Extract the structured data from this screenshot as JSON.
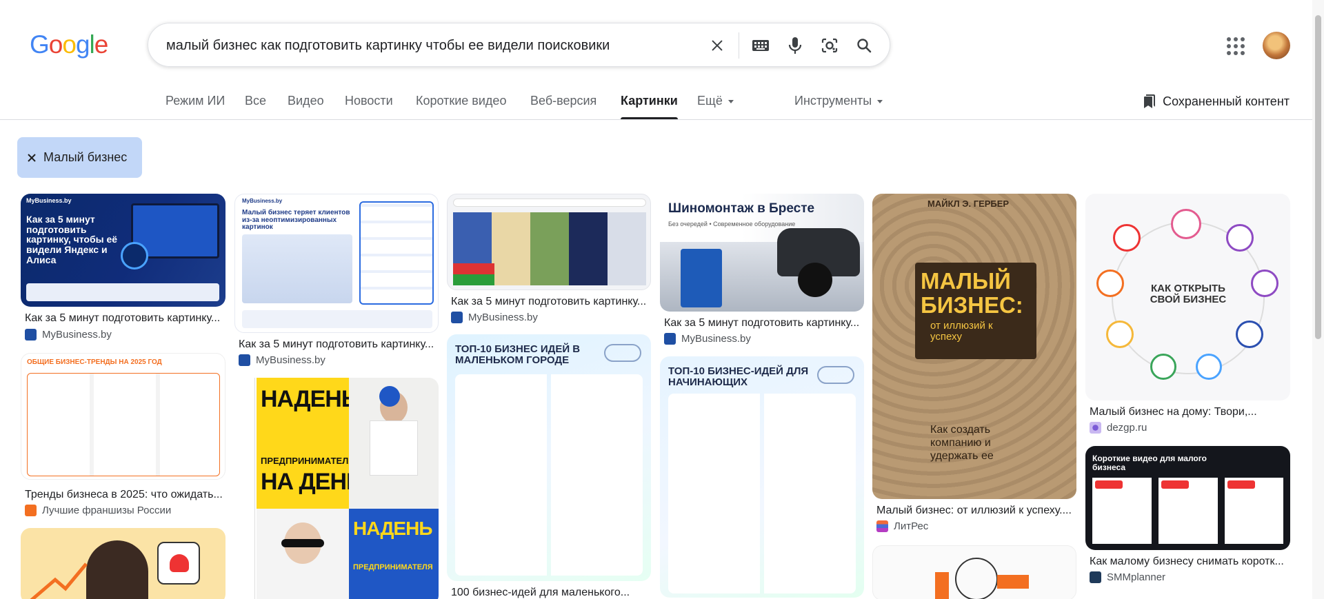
{
  "header": {
    "logo_letters": [
      {
        "ch": "G",
        "color": "#4285F4"
      },
      {
        "ch": "o",
        "color": "#EA4335"
      },
      {
        "ch": "o",
        "color": "#FBBC05"
      },
      {
        "ch": "g",
        "color": "#4285F4"
      },
      {
        "ch": "l",
        "color": "#34A853"
      },
      {
        "ch": "e",
        "color": "#EA4335"
      }
    ],
    "query": "малый бизнес как подготовить картинку чтобы ее видели поисковики"
  },
  "tabs": {
    "ai": "Режим ИИ",
    "all": "Все",
    "video": "Видео",
    "news": "Новости",
    "shorts": "Короткие видео",
    "web": "Веб-версия",
    "images": "Картинки",
    "more": "Ещё",
    "tools": "Инструменты",
    "saved": "Сохраненный контент"
  },
  "chip": {
    "label": "Малый бизнес"
  },
  "results": {
    "r1": {
      "caption": "Как за 5 минут подготовить картинку...",
      "source": "MyBusiness.by",
      "thumb": "Как за 5 минут подготовить картинку, чтобы её видели Яндекс и Алиса",
      "brand": "MyBusiness.by"
    },
    "r2": {
      "caption": "Как за 5 минут подготовить картинку...",
      "source": "MyBusiness.by",
      "thumb": "Малый бизнес теряет клиентов из-за неоптимизированных картинок",
      "brand": "MyBusiness.by"
    },
    "r3": {
      "caption": "Как за 5 минут подготовить картинку...",
      "source": "MyBusiness.by"
    },
    "r4": {
      "caption": "Как за 5 минут подготовить картинку...",
      "source": "MyBusiness.by",
      "thumb": "Шиномонтаж в Бресте",
      "sub": "Без очередей • Современное оборудование"
    },
    "r5": {
      "caption": "Малый бизнес: от иллюзий к успеху....",
      "source": "ЛитРес",
      "author": "МАЙКЛ Э. ГЕРБЕР",
      "title": "МАЛЫЙ БИЗНЕС:",
      "subtitle": "от иллюзий к успеху",
      "bottom": "Как создать компанию и удержать ее"
    },
    "r6": {
      "caption": "Малый бизнес на дому: Твори,...",
      "source": "dezgp.ru",
      "center": "КАК ОТКРЫТЬ СВОЙ БИЗНЕС"
    },
    "r7": {
      "caption": "Тренды бизнеса в 2025: что ожидать...",
      "source": "Лучшие франшизы России",
      "thumb": "ОБЩИЕ БИЗНЕС-ТРЕНДЫ НА 2025 ГОД"
    },
    "r8": {
      "line1": "НАДЕНЬ",
      "line2": "ПРЕДПРИНИМАТЕЛЯ",
      "line3": "НА ДЕНЬ"
    },
    "r9": {
      "caption": "100 бизнес-идей для маленького...",
      "thumb": "ТОП-10 БИЗНЕС ИДЕЙ В МАЛЕНЬКОМ ГОРОДЕ"
    },
    "r10": {
      "thumb": "ТОП-10 БИЗНЕС-ИДЕЙ ДЛЯ НАЧИНАЮЩИХ"
    },
    "r11": {
      "caption": "Как малому бизнесу снимать коротк...",
      "source": "SMMplanner",
      "thumb": "Короткие видео для малого бизнеса"
    }
  }
}
